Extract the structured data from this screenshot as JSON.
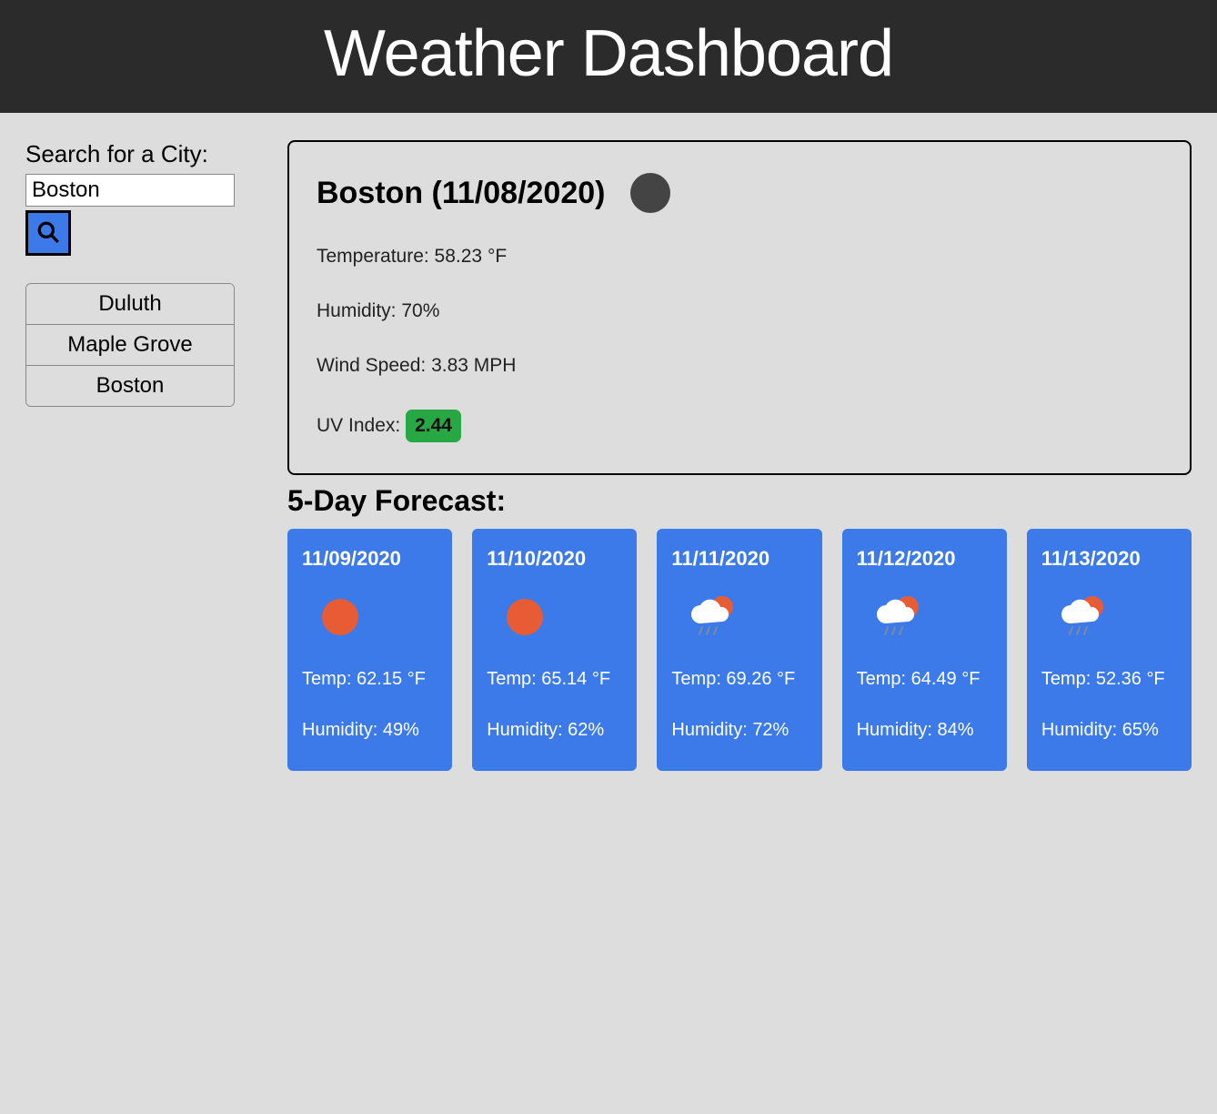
{
  "header": {
    "title": "Weather Dashboard"
  },
  "search": {
    "label": "Search for a City:",
    "value": "Boston",
    "history": [
      "Duluth",
      "Maple Grove",
      "Boston"
    ]
  },
  "current": {
    "title": "Boston (11/08/2020)",
    "temperature_label": "Temperature: 58.23 °F",
    "humidity_label": "Humidity: 70%",
    "wind_label": "Wind Speed: 3.83 MPH",
    "uv_prefix": "UV Index: ",
    "uv_value": "2.44",
    "uv_color": "#28a745",
    "icon": "clouds"
  },
  "forecast": {
    "title": "5-Day Forecast:",
    "days": [
      {
        "date": "11/09/2020",
        "icon": "sun",
        "temp": "Temp: 62.15 °F",
        "humidity": "Humidity: 49%"
      },
      {
        "date": "11/10/2020",
        "icon": "sun",
        "temp": "Temp: 65.14 °F",
        "humidity": "Humidity: 62%"
      },
      {
        "date": "11/11/2020",
        "icon": "rain",
        "temp": "Temp: 69.26 °F",
        "humidity": "Humidity: 72%"
      },
      {
        "date": "11/12/2020",
        "icon": "rain",
        "temp": "Temp: 64.49 °F",
        "humidity": "Humidity: 84%"
      },
      {
        "date": "11/13/2020",
        "icon": "rain",
        "temp": "Temp: 52.36 °F",
        "humidity": "Humidity: 65%"
      }
    ]
  }
}
